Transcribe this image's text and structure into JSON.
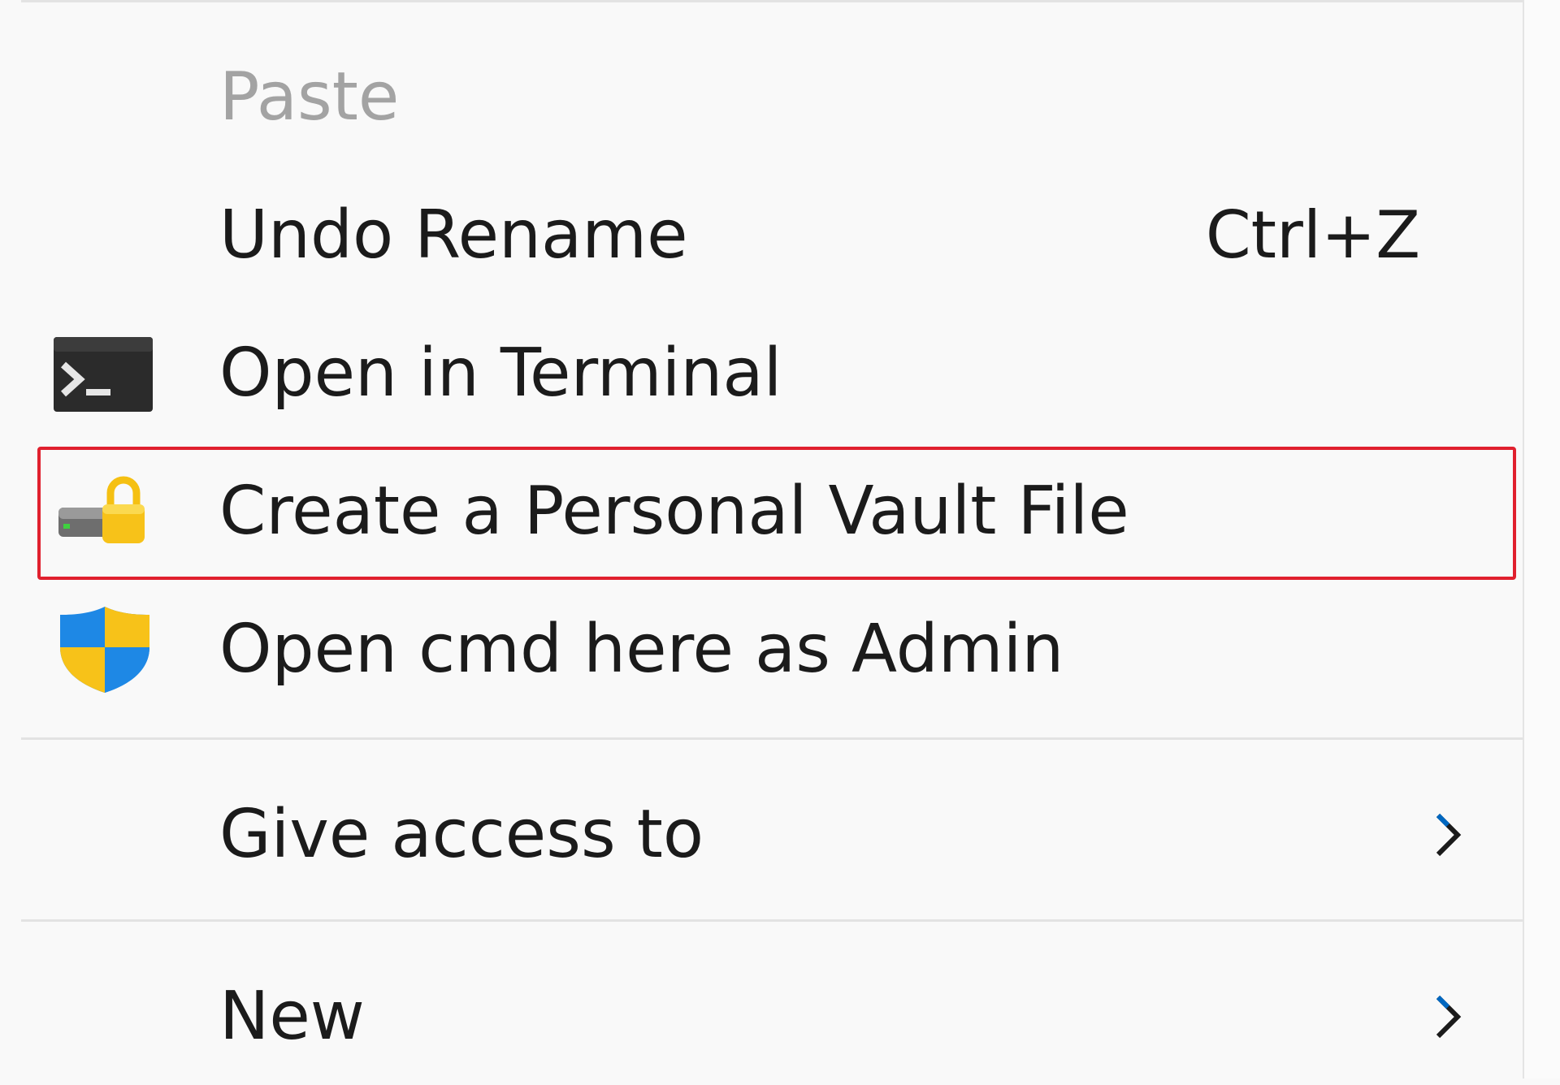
{
  "context_menu": {
    "items": [
      {
        "label": "Paste",
        "disabled": true
      },
      {
        "label": "Undo Rename",
        "shortcut": "Ctrl+Z"
      },
      {
        "label": "Open in Terminal",
        "icon": "terminal-icon"
      },
      {
        "label": "Create a Personal Vault File",
        "icon": "vault-lock-icon",
        "highlighted": true
      },
      {
        "label": "Open cmd here as Admin",
        "icon": "uac-shield-icon"
      },
      {
        "label": "Give access to",
        "submenu": true
      },
      {
        "label": "New",
        "submenu": true
      }
    ],
    "colors": {
      "background": "#f9f9f9",
      "text": "#1b1b1b",
      "disabled_text": "#a3a3a3",
      "highlight_border": "#e0202e",
      "chevron": "#0067c0"
    }
  }
}
